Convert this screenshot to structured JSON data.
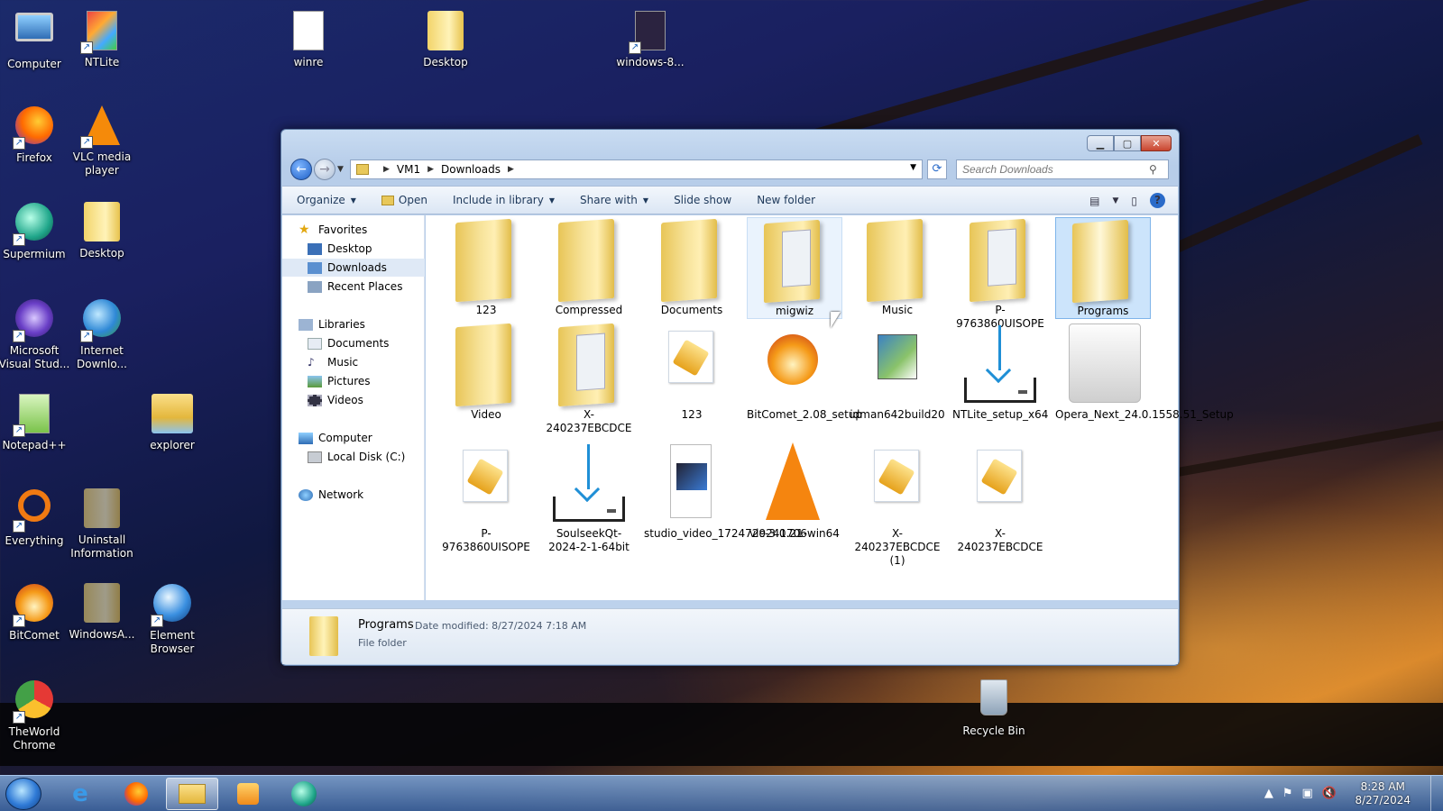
{
  "desktop": {
    "icons": [
      {
        "label": "Computer",
        "icon": "computer-icon"
      },
      {
        "label": "NTLite",
        "icon": "ntlite-icon"
      },
      {
        "label": "winre",
        "icon": "disc-image-icon"
      },
      {
        "label": "Desktop",
        "icon": "folder-icon"
      },
      {
        "label": "windows-8...",
        "icon": "firefox-file-icon"
      },
      {
        "label": "Firefox",
        "icon": "firefox-icon"
      },
      {
        "label": "VLC media player",
        "icon": "vlc-icon"
      },
      {
        "label": "Supermium",
        "icon": "supermium-icon"
      },
      {
        "label": "Desktop",
        "icon": "folder-icon"
      },
      {
        "label": "Microsoft Visual Stud...",
        "icon": "visual-studio-icon"
      },
      {
        "label": "Internet Downlo...",
        "icon": "idm-icon"
      },
      {
        "label": "Notepad++",
        "icon": "notepadpp-icon"
      },
      {
        "label": "explorer",
        "icon": "explorer-folder-icon"
      },
      {
        "label": "Everything",
        "icon": "everything-search-icon"
      },
      {
        "label": "Uninstall Information",
        "icon": "folder-icon"
      },
      {
        "label": "BitComet",
        "icon": "bitcomet-icon"
      },
      {
        "label": "WindowsA...",
        "icon": "folder-icon"
      },
      {
        "label": "Element Browser",
        "icon": "element-browser-icon"
      },
      {
        "label": "TheWorld Chrome",
        "icon": "theworld-chrome-icon"
      },
      {
        "label": "Recycle Bin",
        "icon": "recycle-bin-icon"
      }
    ]
  },
  "explorer": {
    "breadcrumb": [
      "VM1",
      "Downloads"
    ],
    "search_placeholder": "Search Downloads",
    "toolbar": {
      "organize": "Organize",
      "open": "Open",
      "include_in_library": "Include in library",
      "share_with": "Share with",
      "slide_show": "Slide show",
      "new_folder": "New folder"
    },
    "nav": {
      "favorites": "Favorites",
      "desktop": "Desktop",
      "downloads": "Downloads",
      "recent_places": "Recent Places",
      "libraries": "Libraries",
      "documents": "Documents",
      "music": "Music",
      "pictures": "Pictures",
      "videos": "Videos",
      "computer": "Computer",
      "local_disk": "Local Disk (C:)",
      "network": "Network"
    },
    "items": [
      {
        "name": "123",
        "kind": "folder"
      },
      {
        "name": "Compressed",
        "kind": "folder"
      },
      {
        "name": "Documents",
        "kind": "folder"
      },
      {
        "name": "migwiz",
        "kind": "folder-docs"
      },
      {
        "name": "Music",
        "kind": "folder"
      },
      {
        "name": "P-9763860UISOPE",
        "kind": "folder-docs"
      },
      {
        "name": "Programs",
        "kind": "folder"
      },
      {
        "name": "Video",
        "kind": "folder"
      },
      {
        "name": "X-240237EBCDCE",
        "kind": "folder-docs"
      },
      {
        "name": "123",
        "kind": "package"
      },
      {
        "name": "BitComet_2.08_setup",
        "kind": "bitcomet"
      },
      {
        "name": "idman642build20",
        "kind": "idman"
      },
      {
        "name": "NTLite_setup_x64",
        "kind": "download"
      },
      {
        "name": "Opera_Next_24.0.1558.51_Setup",
        "kind": "opera"
      },
      {
        "name": "P-9763860UISOPE",
        "kind": "package"
      },
      {
        "name": "SoulseekQt-2024-2-1-64bit",
        "kind": "download"
      },
      {
        "name": "studio_video_1724729241706",
        "kind": "video"
      },
      {
        "name": "vlc-3.0.21-win64",
        "kind": "vlc"
      },
      {
        "name": "X-240237EBCDCE (1)",
        "kind": "package"
      },
      {
        "name": "X-240237EBCDCE",
        "kind": "package"
      }
    ],
    "selected_item": "Programs",
    "details": {
      "name": "Programs",
      "modified_label": "Date modified:",
      "modified_value": "8/27/2024 7:18 AM",
      "type": "File folder"
    }
  },
  "taskbar": {
    "time": "8:28 AM",
    "date": "8/27/2024"
  }
}
